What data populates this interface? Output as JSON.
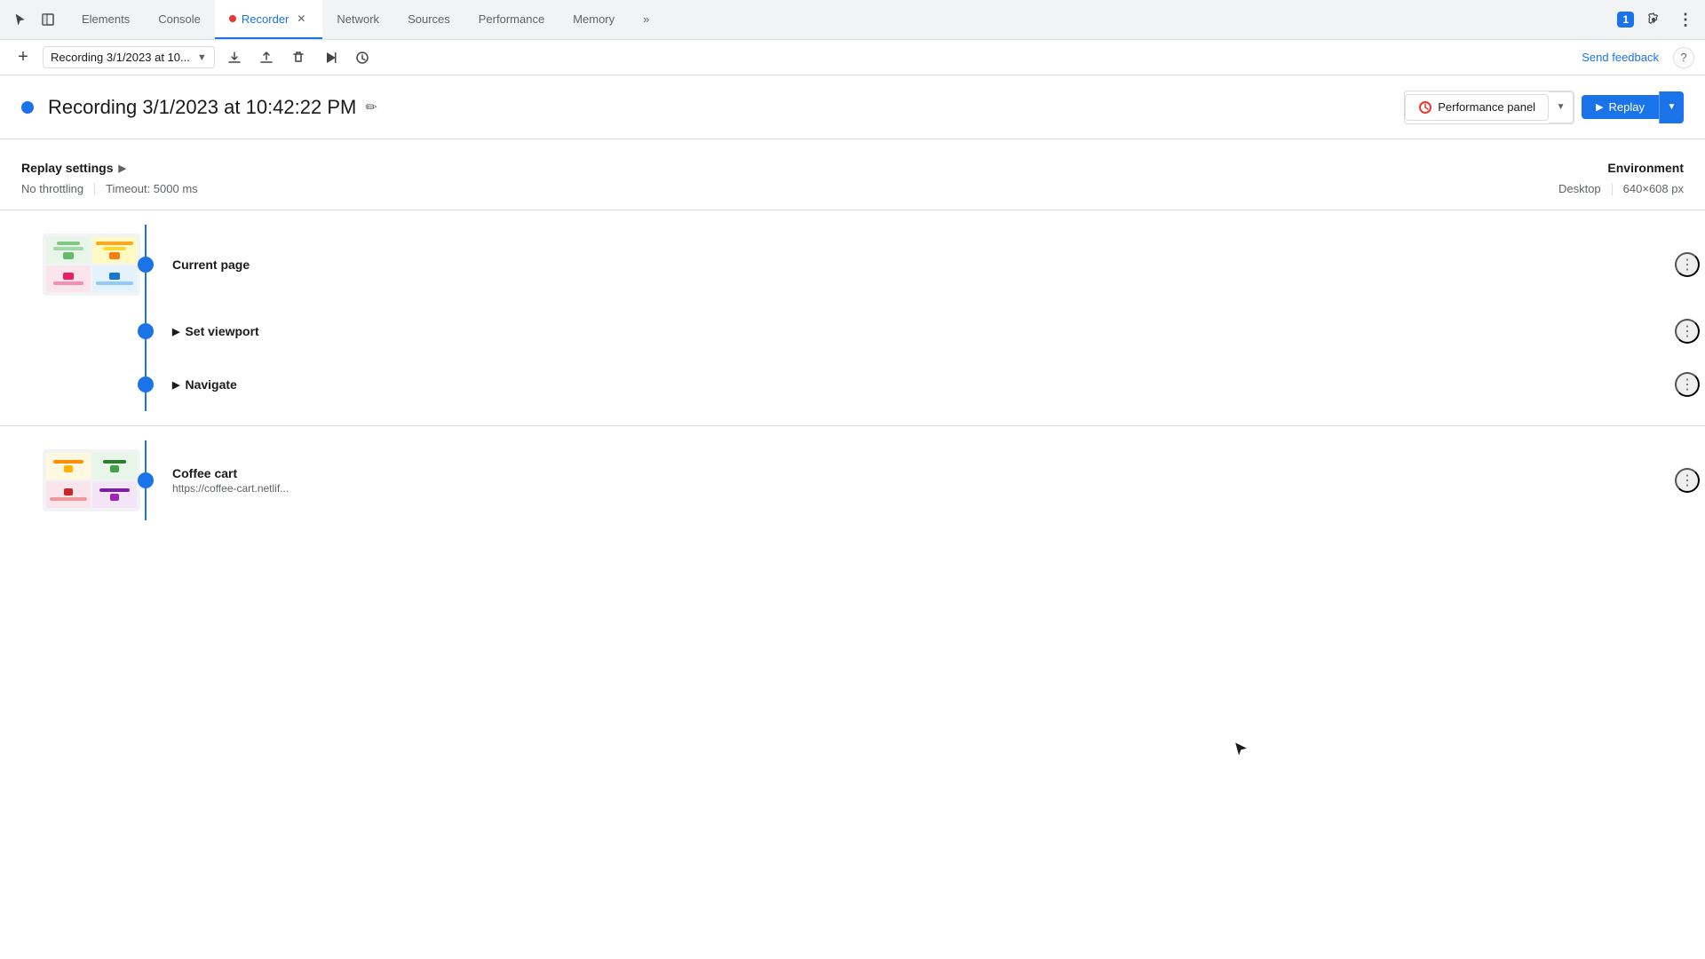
{
  "tabs": {
    "items": [
      {
        "label": "Elements",
        "active": false,
        "hasClose": false,
        "hasDot": false
      },
      {
        "label": "Console",
        "active": false,
        "hasClose": false,
        "hasDot": false
      },
      {
        "label": "Recorder",
        "active": true,
        "hasClose": true,
        "hasDot": true
      },
      {
        "label": "Network",
        "active": false,
        "hasClose": false,
        "hasDot": false
      },
      {
        "label": "Sources",
        "active": false,
        "hasClose": false,
        "hasDot": false
      },
      {
        "label": "Performance",
        "active": false,
        "hasClose": false,
        "hasDot": false
      },
      {
        "label": "Memory",
        "active": false,
        "hasClose": false,
        "hasDot": false
      }
    ],
    "more_label": "»"
  },
  "toolbar": {
    "add_label": "+",
    "recording_name": "Recording 3/1/2023 at 10...",
    "send_feedback_label": "Send feedback",
    "help_label": "?"
  },
  "header": {
    "recording_title": "Recording 3/1/2023 at 10:42:22 PM",
    "performance_panel_label": "Performance panel",
    "replay_label": "Replay",
    "dropdown_label": "▼"
  },
  "replay_settings": {
    "title": "Replay settings",
    "throttling": "No throttling",
    "timeout": "Timeout: 5000 ms",
    "env_title": "Environment",
    "env_type": "Desktop",
    "env_resolution": "640×608 px"
  },
  "steps": {
    "page1": {
      "label": "Current page",
      "sub_steps": [
        {
          "label": "Set viewport",
          "expandable": true
        },
        {
          "label": "Navigate",
          "expandable": true
        }
      ]
    },
    "page2": {
      "label": "Coffee cart",
      "url": "https://coffee-cart.netlif..."
    }
  },
  "icons": {
    "cursor": "⬆",
    "edit": "✏",
    "expand": "▶",
    "more": "⋮",
    "play": "▶",
    "settings": "⚙",
    "menu": "⋮",
    "chevron": "›",
    "chat": "1"
  },
  "colors": {
    "blue": "#1a73e8",
    "blue_dark": "#1557b0",
    "red": "#e53935",
    "gray_border": "#dadce0",
    "gray_text": "#5f6368",
    "bg_light": "#f1f3f4"
  }
}
